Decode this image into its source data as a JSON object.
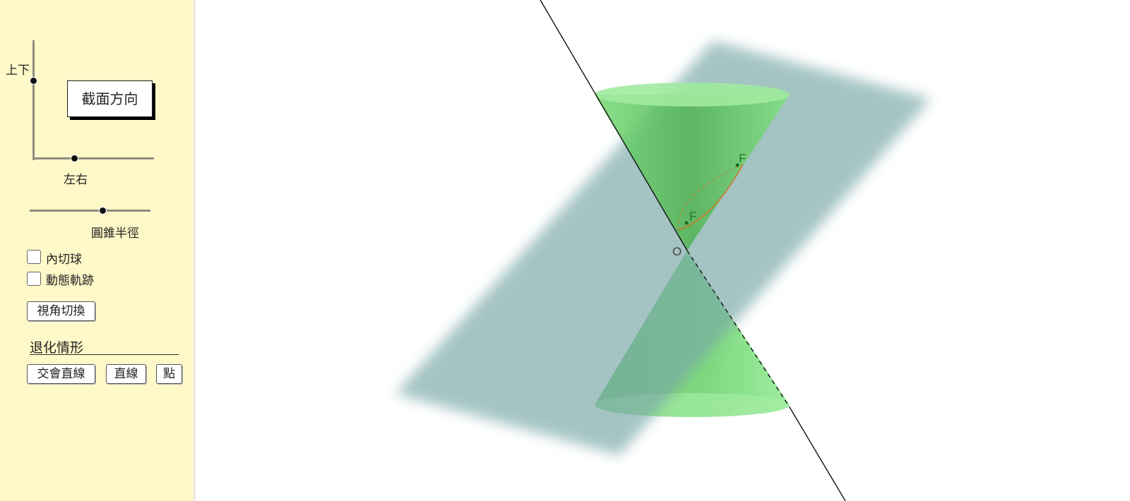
{
  "sidebar": {
    "vertical_slider_label": "上下",
    "horizontal_slider_label": "左右",
    "section_direction_button": "截面方向",
    "radius_slider_label": "圓錐半徑",
    "radius_value": 0.6,
    "checkboxes": [
      {
        "label": "內切球",
        "checked": false
      },
      {
        "label": "動態軌跡",
        "checked": false
      }
    ],
    "view_toggle_button": "視角切換",
    "degenerate_heading": "退化情形",
    "degenerate_buttons": [
      "交會直線",
      "直線",
      "點"
    ]
  },
  "scene": {
    "point_labels": {
      "focus_upper": "F",
      "focus_lower": "F",
      "origin": "O"
    },
    "colors": {
      "cone": "#5fd35f",
      "plane": "#7aa8a8",
      "curve": "#c87a2a",
      "axis": "#111111"
    }
  }
}
